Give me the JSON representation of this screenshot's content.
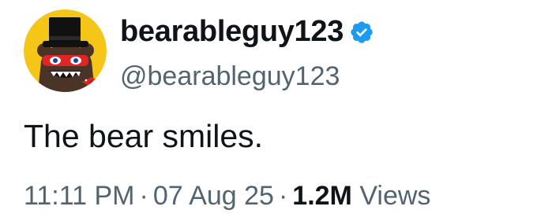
{
  "user": {
    "display_name": "bearableguy123",
    "handle": "@bearableguy123",
    "verified": true,
    "verified_color": "#1d9bf0",
    "avatar_bg": "#f5c518",
    "avatar_icon": "bear-with-top-hat-avatar"
  },
  "tweet": {
    "text": "The bear smiles."
  },
  "meta": {
    "time": "11:11 PM",
    "separator": "·",
    "date": "07 Aug 25",
    "views_count": "1.2M",
    "views_label": "Views"
  },
  "colors": {
    "primary_text": "#0f1419",
    "secondary_text": "#536471"
  }
}
